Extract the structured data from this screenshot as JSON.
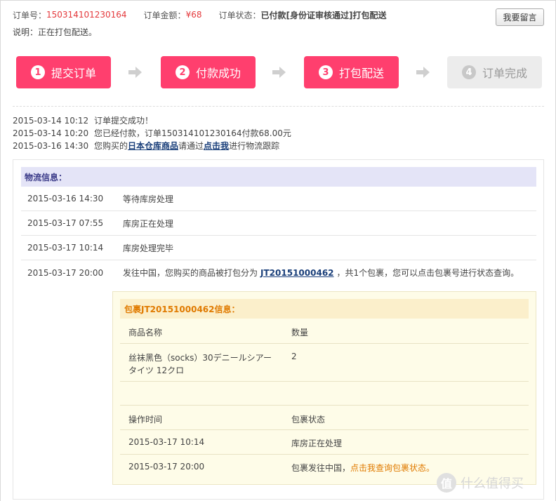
{
  "header": {
    "order_no_label": "订单号：",
    "order_no": "150314101230164",
    "amount_label": "订单金额：",
    "amount": "¥68",
    "status_label": "订单状态：",
    "status": "已付款[身份证审核通过]打包配送",
    "message_button": "我要留言",
    "note": "说明：正在打包配送。"
  },
  "steps": [
    {
      "num": "1",
      "label": "提交订单"
    },
    {
      "num": "2",
      "label": "付款成功"
    },
    {
      "num": "3",
      "label": "打包配送"
    },
    {
      "num": "4",
      "label": "订单完成"
    }
  ],
  "order_log": [
    {
      "time": "2015-03-14 10:12",
      "text": "订单提交成功！"
    },
    {
      "time": "2015-03-14 10:20",
      "text": "您已经付款，订单150314101230164付款68.00元"
    },
    {
      "time": "2015-03-16 14:30",
      "pre": "您购买的",
      "link1": "日本仓库商品",
      "mid": "请通过",
      "link2": "点击我",
      "post": "进行物流跟踪"
    }
  ],
  "logistics": {
    "title": "物流信息：",
    "rows": [
      {
        "time": "2015-03-16 14:30",
        "text": "等待库房处理"
      },
      {
        "time": "2015-03-17 07:55",
        "text": "库房正在处理"
      },
      {
        "time": "2015-03-17 10:14",
        "text": "库房处理完毕"
      },
      {
        "time": "2015-03-17 20:00",
        "pre": "发往中国，您购买的商品被打包分为",
        "link": "JT20151000462",
        "post": "，共1个包裹，您可以点击包裹号进行状态查询。"
      }
    ]
  },
  "package": {
    "title": "包裹JT20151000462信息：",
    "col_product": "商品名称",
    "col_qty": "数量",
    "product_line1": "丝袜黑色（socks）30デニールシアー",
    "product_line2": "タイツ 12クロ",
    "qty": "2",
    "col_time": "操作时间",
    "col_status": "包裹状态",
    "events": [
      {
        "time": "2015-03-17 10:14",
        "status": "库房正在处理"
      },
      {
        "time": "2015-03-17 20:00",
        "status": "包裹发往中国，",
        "link": "点击我查询包裹状态。"
      }
    ]
  },
  "watermark": {
    "text": "什么值得买",
    "badge": "值"
  }
}
